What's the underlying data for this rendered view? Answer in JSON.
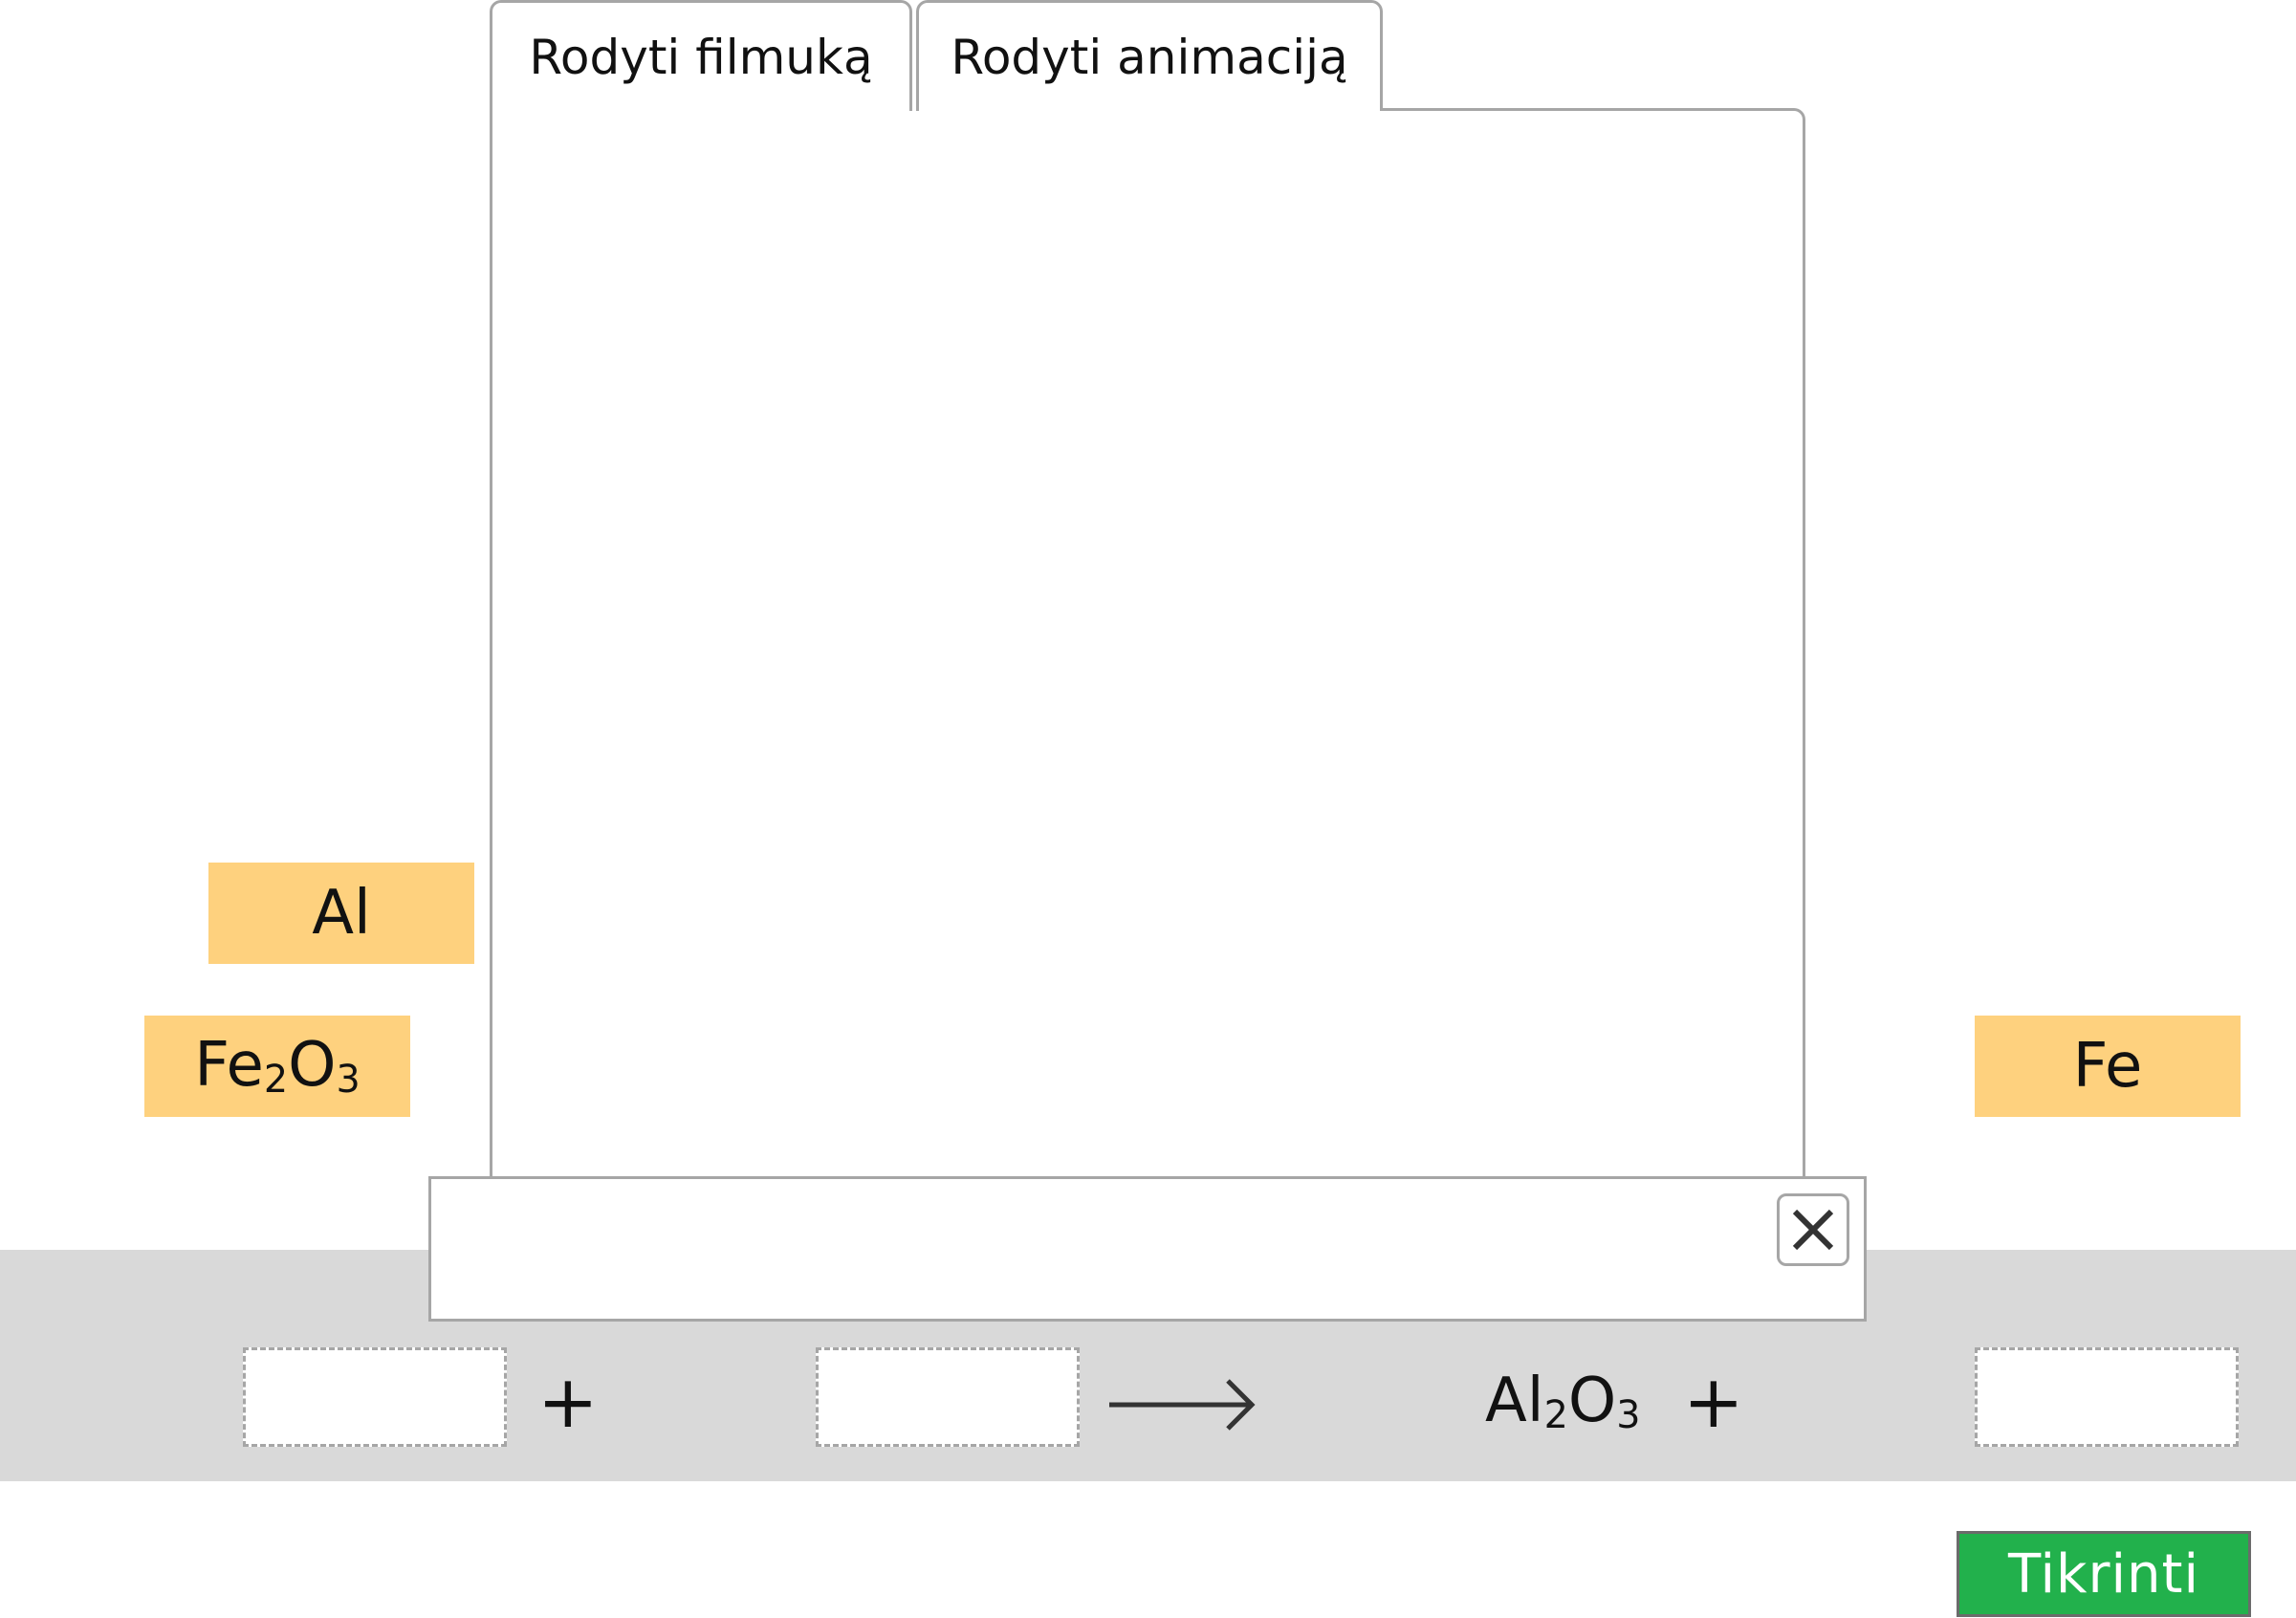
{
  "tabs": [
    {
      "label": "Rodyti filmuką"
    },
    {
      "label": "Rodyti animaciją"
    }
  ],
  "chips": {
    "al": {
      "label": "Al"
    },
    "fe2o3": {
      "base1": "Fe",
      "sub1": "2",
      "base2": "O",
      "sub2": "3"
    },
    "fe": {
      "label": "Fe"
    }
  },
  "equation": {
    "plus_1": "+",
    "plus_2": "+",
    "product": {
      "base1": "Al",
      "sub1": "2",
      "base2": "O",
      "sub2": "3"
    },
    "arrow_icon": "long-right-arrow-icon"
  },
  "caption": {
    "close_icon": "close-icon"
  },
  "check_button": {
    "label": "Tikrinti"
  },
  "colors": {
    "chip": "#fed17e",
    "band": "#d9d9d9",
    "check_button": "#22b14c",
    "border": "#a6a6a6"
  }
}
